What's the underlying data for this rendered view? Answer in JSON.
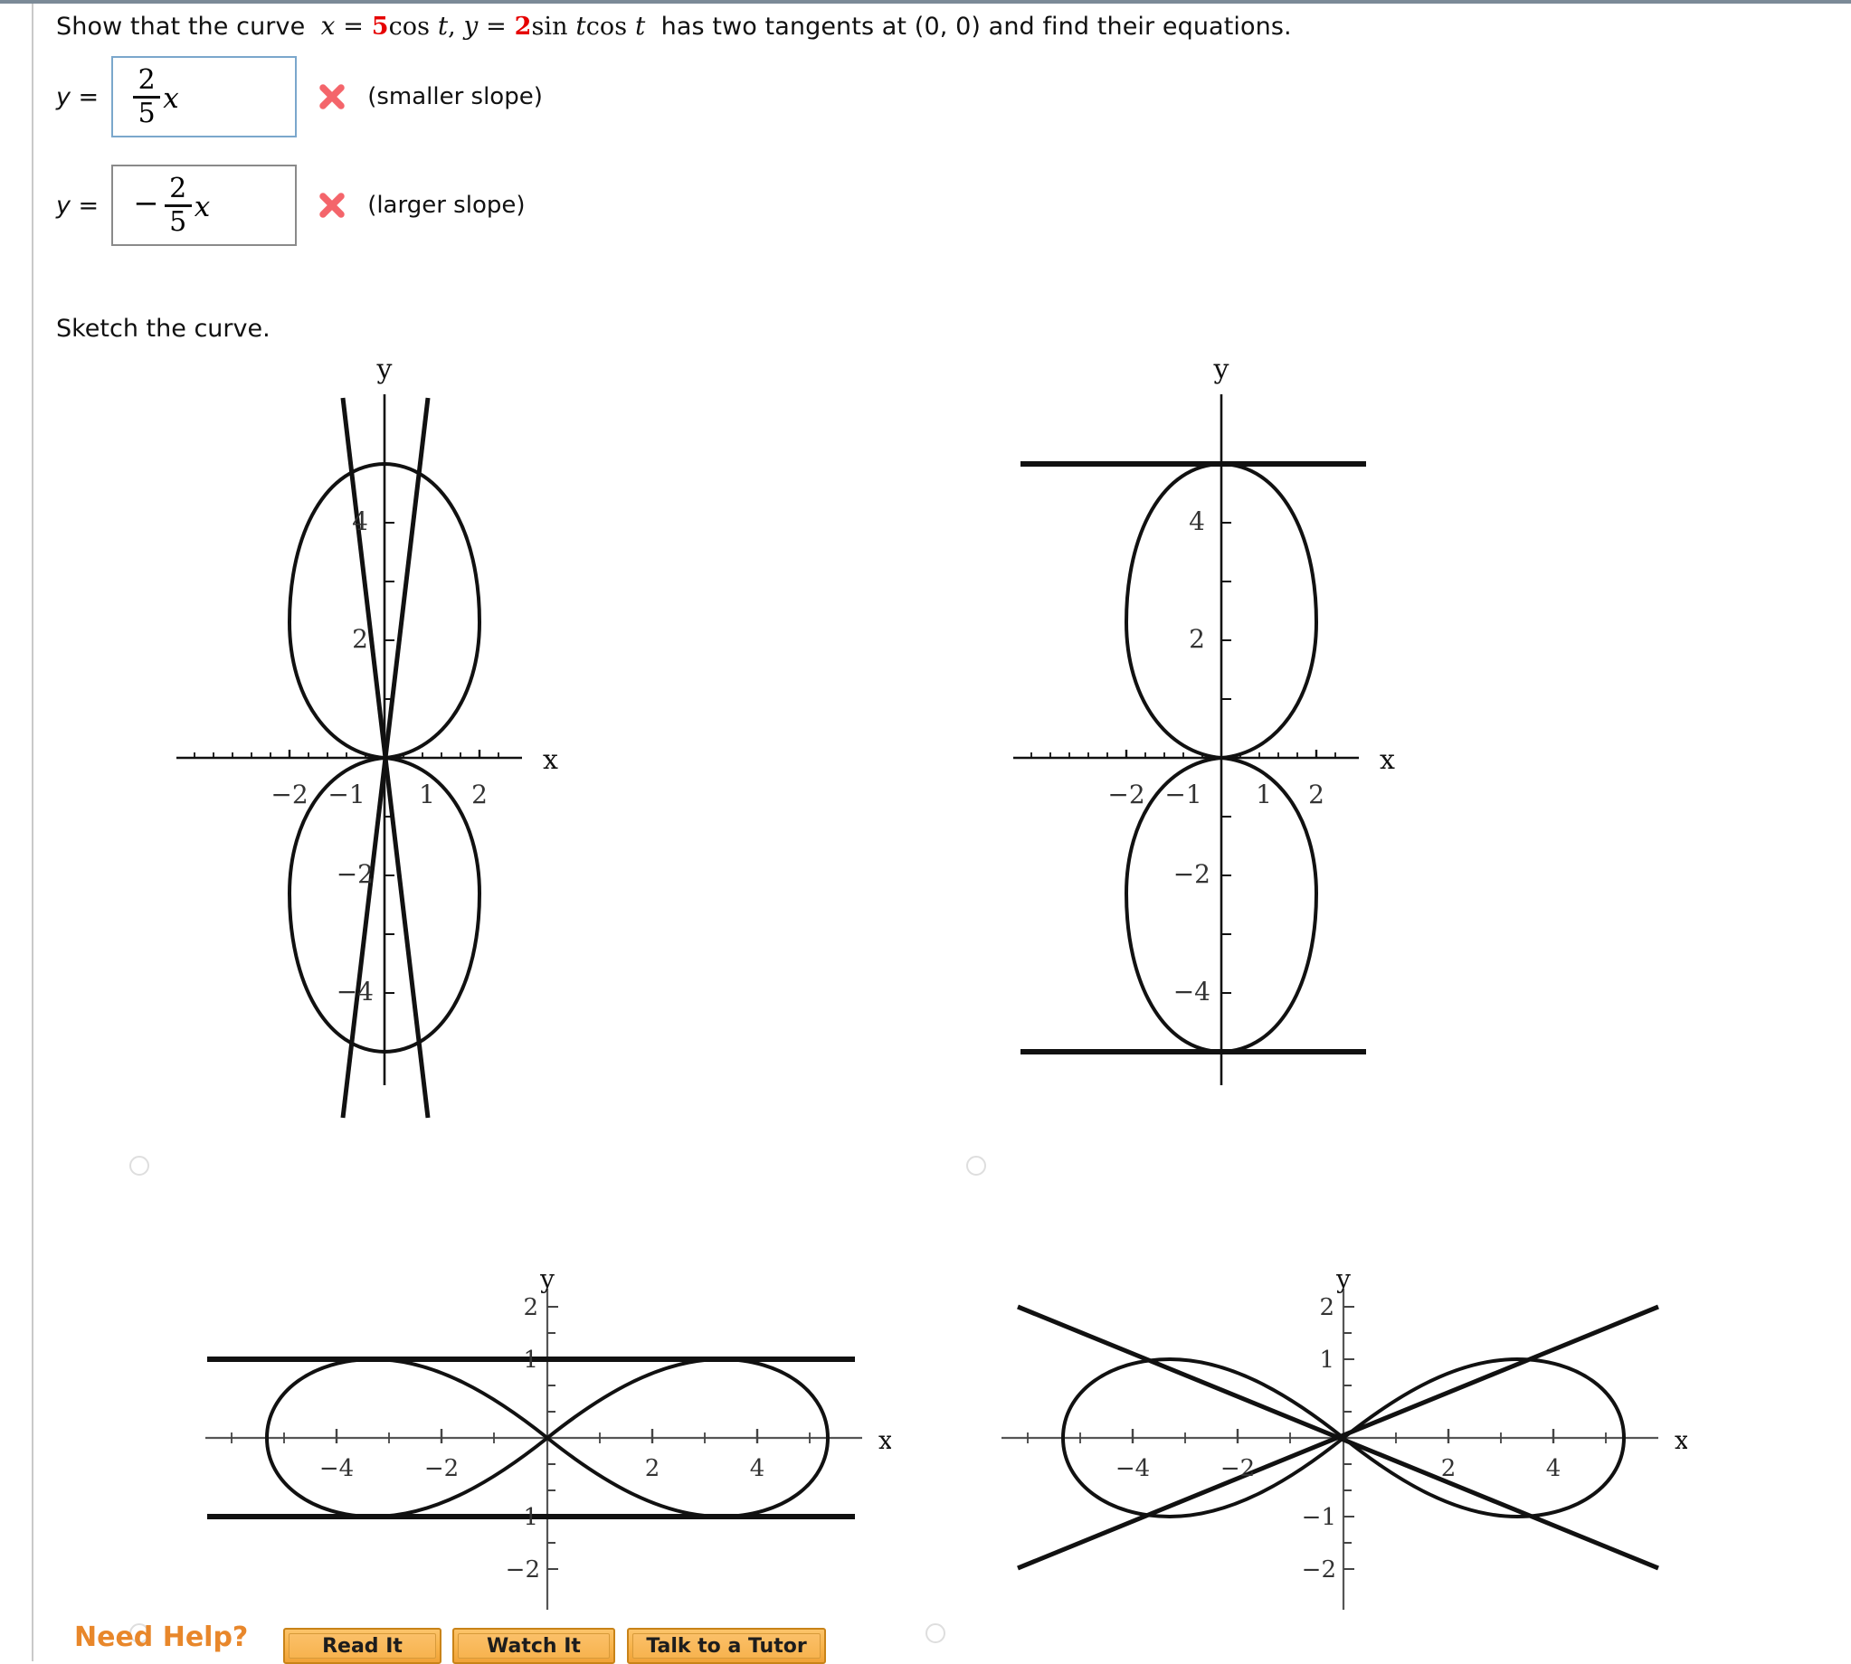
{
  "question": {
    "lead": "Show that the curve",
    "eq_x_var": "x",
    "eq_eq1": "=",
    "eq_x_coef": "5",
    "eq_x_fn": "cos",
    "eq_t1": "t",
    "comma": ",",
    "eq_y_var": "y",
    "eq_eq2": "=",
    "eq_y_coef": "2",
    "eq_y_fn1": "sin",
    "eq_t2": "t",
    "eq_y_fn2": "cos",
    "eq_t3": "t",
    "tail": "has two tangents at (0, 0) and find their equations.",
    "full_text": "Show that the curve x = 5 cos t, y = 2 sin t cos t has two tangents at (0, 0) and find their equations."
  },
  "answers": [
    {
      "y_label": "y =",
      "sign": "",
      "numerator": "2",
      "denominator": "5",
      "variable": "x",
      "value_text": "2/5 x",
      "status_icon": "cross-icon",
      "status": "incorrect",
      "note": "(smaller slope)",
      "focused": true
    },
    {
      "y_label": "y =",
      "sign": "−",
      "numerator": "2",
      "denominator": "5",
      "variable": "x",
      "value_text": "-2/5 x",
      "status_icon": "cross-icon",
      "status": "incorrect",
      "note": "(larger slope)",
      "focused": false
    }
  ],
  "sketch_prompt": "Sketch the curve.",
  "colors": {
    "red_accent": "#e60000",
    "cross_red": "#f4656b",
    "focus_border": "#7ba7cc",
    "plain_border": "#8a8a8a",
    "help_orange": "#e8872b",
    "button_fill": "#f8b44c",
    "top_rule": "#7b8a97"
  },
  "chart_data": [
    {
      "id": "option-a",
      "type": "line",
      "title": "",
      "xlabel": "x",
      "ylabel": "y",
      "xlim": [
        -2.6,
        2.6
      ],
      "ylim": [
        -5.8,
        5.8
      ],
      "xticks": [
        -2,
        -1,
        1,
        2
      ],
      "xtick_labels": [
        "−2",
        "−1",
        "1",
        "2"
      ],
      "yticks": [
        -4,
        -2,
        2,
        4
      ],
      "ytick_labels": [
        "−4",
        "−2",
        "2",
        "4"
      ],
      "grid": false,
      "legend": null,
      "description": "Vertical figure-eight lemniscate (x = 2 sin t cos t, y = 5 cos t) with two straight tangent lines of steep slope crossing at the origin",
      "curve": {
        "name": "vertical figure-eight",
        "param_x": "2 sin t cos t",
        "param_y": "5 cos t"
      },
      "tangents": [
        {
          "name": "tangent-1",
          "slope": 5.0,
          "intercept": 0
        },
        {
          "name": "tangent-2",
          "slope": -5.0,
          "intercept": 0
        }
      ],
      "selected": false
    },
    {
      "id": "option-b",
      "type": "line",
      "title": "",
      "xlabel": "x",
      "ylabel": "y",
      "xlim": [
        -2.6,
        2.6
      ],
      "ylim": [
        -5.8,
        5.8
      ],
      "xticks": [
        -2,
        -1,
        1,
        2
      ],
      "xtick_labels": [
        "−2",
        "−1",
        "1",
        "2"
      ],
      "yticks": [
        -4,
        -2,
        2,
        4
      ],
      "ytick_labels": [
        "−4",
        "−2",
        "2",
        "4"
      ],
      "grid": false,
      "legend": null,
      "description": "Vertical figure-eight lemniscate with two horizontal tangent lines at y = 5 and y = -5",
      "curve": {
        "name": "vertical figure-eight",
        "param_x": "2 sin t cos t",
        "param_y": "5 cos t"
      },
      "tangents": [
        {
          "name": "tangent-1",
          "slope": 0,
          "intercept": 5
        },
        {
          "name": "tangent-2",
          "slope": 0,
          "intercept": -5
        }
      ],
      "selected": false
    },
    {
      "id": "option-c",
      "type": "line",
      "title": "",
      "xlabel": "x",
      "ylabel": "y",
      "xlim": [
        -5.8,
        5.8
      ],
      "ylim": [
        -2.6,
        2.6
      ],
      "xticks": [
        -4,
        -2,
        2,
        4
      ],
      "xtick_labels": [
        "−4",
        "−2",
        "2",
        "4"
      ],
      "yticks": [
        -2,
        -1,
        1,
        2
      ],
      "ytick_labels": [
        "−2",
        "−1",
        "1",
        "2"
      ],
      "grid": false,
      "legend": null,
      "description": "Horizontal figure-eight lemniscate with two horizontal tangent lines at y = 1 and y = -1",
      "curve": {
        "name": "horizontal figure-eight",
        "param_x": "5 cos t",
        "param_y": "2 sin t cos t"
      },
      "tangents": [
        {
          "name": "tangent-1",
          "slope": 0,
          "intercept": 1
        },
        {
          "name": "tangent-2",
          "slope": 0,
          "intercept": -1
        }
      ],
      "selected": false
    },
    {
      "id": "option-d",
      "type": "line",
      "title": "",
      "xlabel": "x",
      "ylabel": "y",
      "xlim": [
        -5.8,
        5.8
      ],
      "ylim": [
        -2.6,
        2.6
      ],
      "xticks": [
        -4,
        -2,
        2,
        4
      ],
      "xtick_labels": [
        "−4",
        "−2",
        "2",
        "4"
      ],
      "yticks": [
        -2,
        -1,
        1,
        2
      ],
      "ytick_labels": [
        "−2",
        "−1",
        "1",
        "2"
      ],
      "grid": false,
      "legend": null,
      "description": "Horizontal figure-eight lemniscate with two straight tangent lines through the origin of slopes +2/5 and -2/5",
      "curve": {
        "name": "horizontal figure-eight",
        "param_x": "5 cos t",
        "param_y": "2 sin t cos t"
      },
      "tangents": [
        {
          "name": "tangent-1",
          "slope": 0.4,
          "intercept": 0
        },
        {
          "name": "tangent-2",
          "slope": -0.4,
          "intercept": 0
        }
      ],
      "selected": false
    }
  ],
  "footer": {
    "need_help_label": "Need Help?",
    "buttons": [
      {
        "label": "Read It",
        "name": "read-it-button"
      },
      {
        "label": "Watch It",
        "name": "watch-it-button"
      },
      {
        "label": "Talk to a Tutor",
        "name": "talk-to-a-tutor-button"
      }
    ]
  }
}
